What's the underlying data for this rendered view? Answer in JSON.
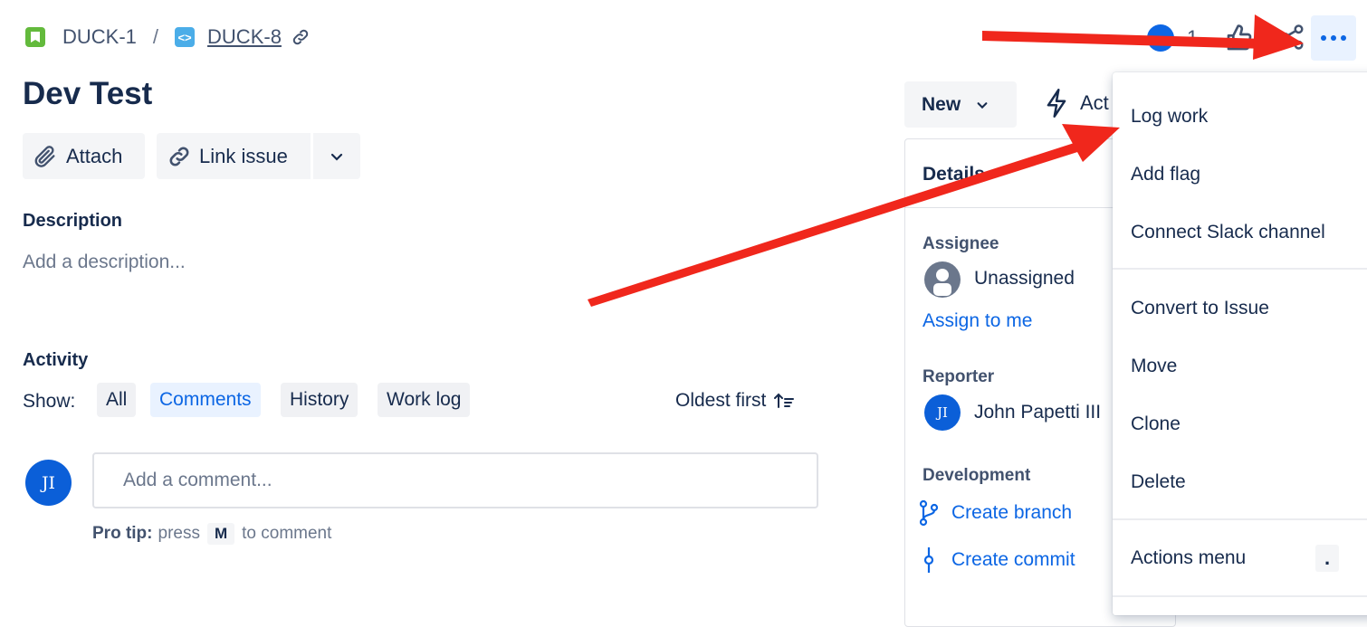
{
  "breadcrumb": {
    "parent_key": "DUCK-1",
    "separator": "/",
    "issue_key": "DUCK-8"
  },
  "issue": {
    "title": "Dev Test"
  },
  "toolbar": {
    "attach_label": "Attach",
    "link_issue_label": "Link issue"
  },
  "description": {
    "heading": "Description",
    "placeholder": "Add a description..."
  },
  "activity": {
    "heading": "Activity",
    "show_label": "Show:",
    "filters": [
      "All",
      "Comments",
      "History",
      "Work log"
    ],
    "active_filter": "Comments",
    "sort_label": "Oldest first",
    "comment_placeholder": "Add a comment...",
    "pro_tip_bold": "Pro tip:",
    "pro_tip_press": "press",
    "pro_tip_key": "M",
    "pro_tip_after": "to comment",
    "user_initials": "JI"
  },
  "header_actions": {
    "watchers_count": "1"
  },
  "status": {
    "label": "New",
    "actions_label": "Act"
  },
  "details": {
    "heading": "Details",
    "assignee_label": "Assignee",
    "assignee_value": "Unassigned",
    "assign_to_me": "Assign to me",
    "reporter_label": "Reporter",
    "reporter_initials": "JI",
    "reporter_name": "John Papetti III",
    "development_label": "Development",
    "create_branch": "Create branch",
    "create_commit": "Create commit"
  },
  "menu": {
    "items_group1": [
      "Log work",
      "Add flag",
      "Connect Slack channel"
    ],
    "items_group2": [
      "Convert to Issue",
      "Move",
      "Clone",
      "Delete"
    ],
    "actions_menu": "Actions menu",
    "actions_shortcut": "."
  },
  "colors": {
    "annotation_arrow": "#f0271c",
    "link": "#0c66e4",
    "accent_bg": "#e9f2ff"
  }
}
